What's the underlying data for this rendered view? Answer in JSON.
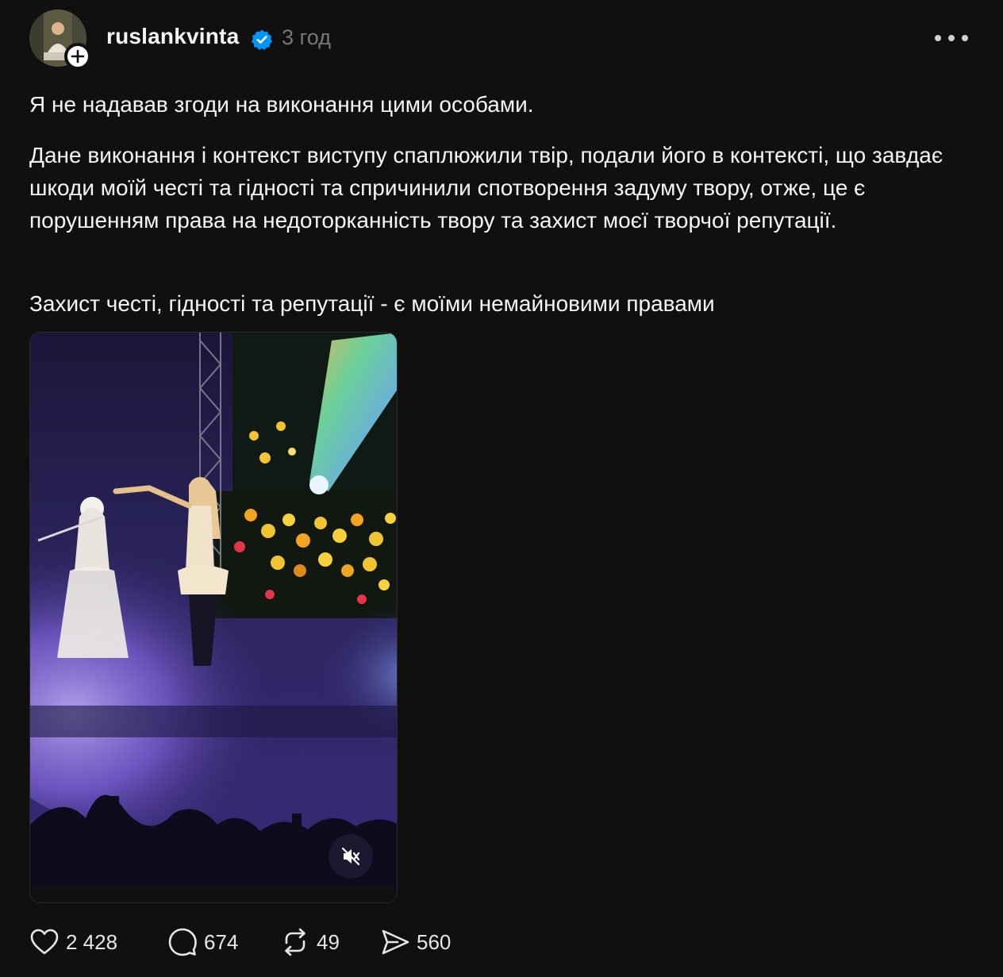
{
  "post": {
    "username": "ruslankvinta",
    "verified": true,
    "time": "3 год",
    "text": {
      "p1": "Я не надавав згоди на виконання цими особами.",
      "p2": "Дане виконання і контекст виступу спаплюжили твір, подали його в контексті, що завдає шкоди моїй честі та гідності та спричинили спотворення задуму твору, отже, це є порушенням права на недоторканність твору та захист моєї творчої репутації.",
      "p3": "Захист честі, гідності та репутації - є моїми немайновими правами"
    },
    "media": {
      "type": "video",
      "muted": true,
      "icon": "speaker-muted-icon"
    }
  },
  "actions": {
    "likes": "2 428",
    "replies": "674",
    "reposts": "49",
    "shares": "560"
  },
  "icons": {
    "follow": "plus-icon",
    "verified": "verified-badge-icon",
    "more": "more-horizontal-icon",
    "like": "heart-icon",
    "reply": "comment-icon",
    "repost": "repost-icon",
    "share": "send-icon"
  },
  "colors": {
    "background": "#101010",
    "text": "#f3f5f7",
    "muted_text": "#777777",
    "verified": "#0095f6"
  }
}
